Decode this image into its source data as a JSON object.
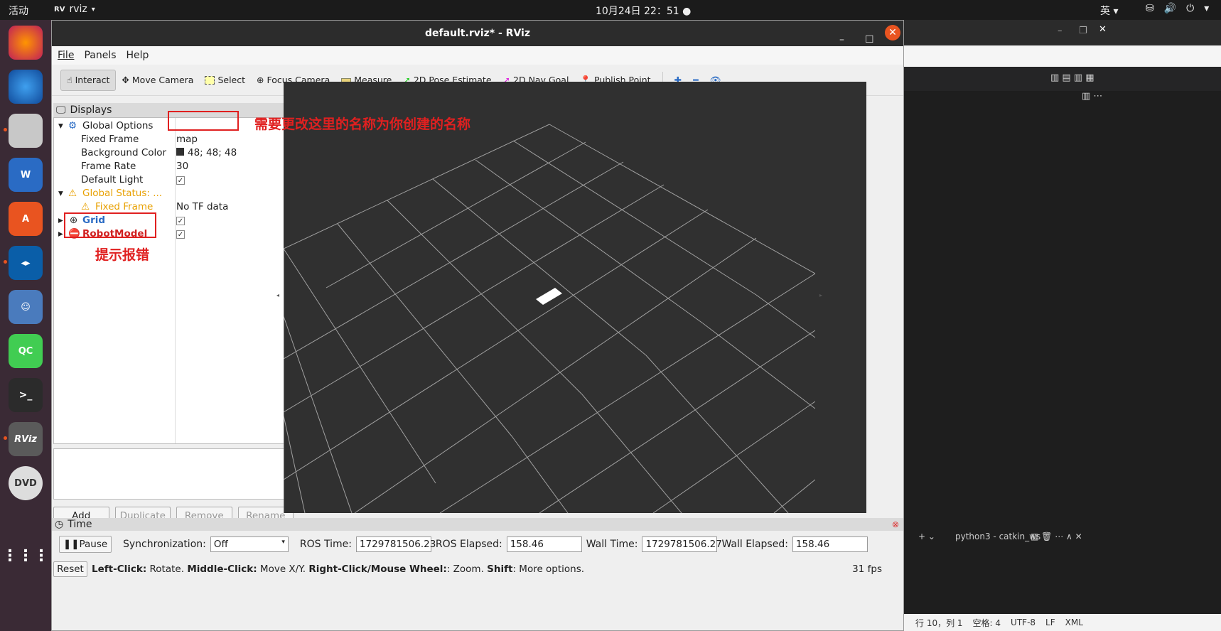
{
  "system": {
    "activities": "活动",
    "app_name": "rviz",
    "clock": "10月24日 22：51",
    "input_method": "英"
  },
  "window": {
    "title": "default.rviz* - RViz"
  },
  "menu": {
    "file": "File",
    "panels": "Panels",
    "help": "Help"
  },
  "toolbar": {
    "interact": "Interact",
    "move_camera": "Move Camera",
    "select": "Select",
    "focus_camera": "Focus Camera",
    "measure": "Measure",
    "pose_estimate": "2D Pose Estimate",
    "nav_goal": "2D Nav Goal",
    "publish_point": "Publish Point"
  },
  "displays": {
    "title": "Displays",
    "global_options": "Global Options",
    "fixed_frame_label": "Fixed Frame",
    "fixed_frame_value": "map",
    "bg_color_label": "Background Color",
    "bg_color_value": "48; 48; 48",
    "frame_rate_label": "Frame Rate",
    "frame_rate_value": "30",
    "default_light_label": "Default Light",
    "global_status": "Global Status: ...",
    "status_fixed_frame": "Fixed Frame",
    "status_fixed_frame_value": "No TF data",
    "grid": "Grid",
    "robot_model": "RobotModel",
    "buttons": {
      "add": "Add",
      "duplicate": "Duplicate",
      "remove": "Remove",
      "rename": "Rename"
    }
  },
  "annotations": {
    "rename_note": "需要更改这里的名称为你创建的名称",
    "error_note": "提示报错"
  },
  "time": {
    "title": "Time",
    "pause": "Pause",
    "sync_label": "Synchronization:",
    "sync_value": "Off",
    "ros_time_label": "ROS Time:",
    "ros_time": "1729781506.23",
    "ros_elapsed_label": "ROS Elapsed:",
    "ros_elapsed": "158.46",
    "wall_time_label": "Wall Time:",
    "wall_time": "1729781506.27",
    "wall_elapsed_label": "Wall Elapsed:",
    "wall_elapsed": "158.46"
  },
  "statusbar": {
    "reset": "Reset",
    "left_click": "Left-Click:",
    "left_click_text": " Rotate. ",
    "middle_click": "Middle-Click:",
    "middle_click_text": " Move X/Y. ",
    "right_click": "Right-Click/Mouse Wheel:",
    "right_click_text": ": Zoom. ",
    "shift": "Shift",
    "shift_text": ": More options.",
    "fps": "31 fps"
  },
  "vscode": {
    "terminal_title": "python3 - catkin_ws",
    "status_line": "行 10，列 1",
    "status_spaces": "空格: 4",
    "status_encoding": "UTF-8",
    "status_eol": "LF",
    "status_lang": "XML"
  },
  "colors": {
    "bg_color_swatch": "#303030",
    "global_status_color": "#e8a000",
    "grid_label_color": "#2a6bc4",
    "error_color": "#d02020",
    "annotation_color": "#e02020"
  }
}
